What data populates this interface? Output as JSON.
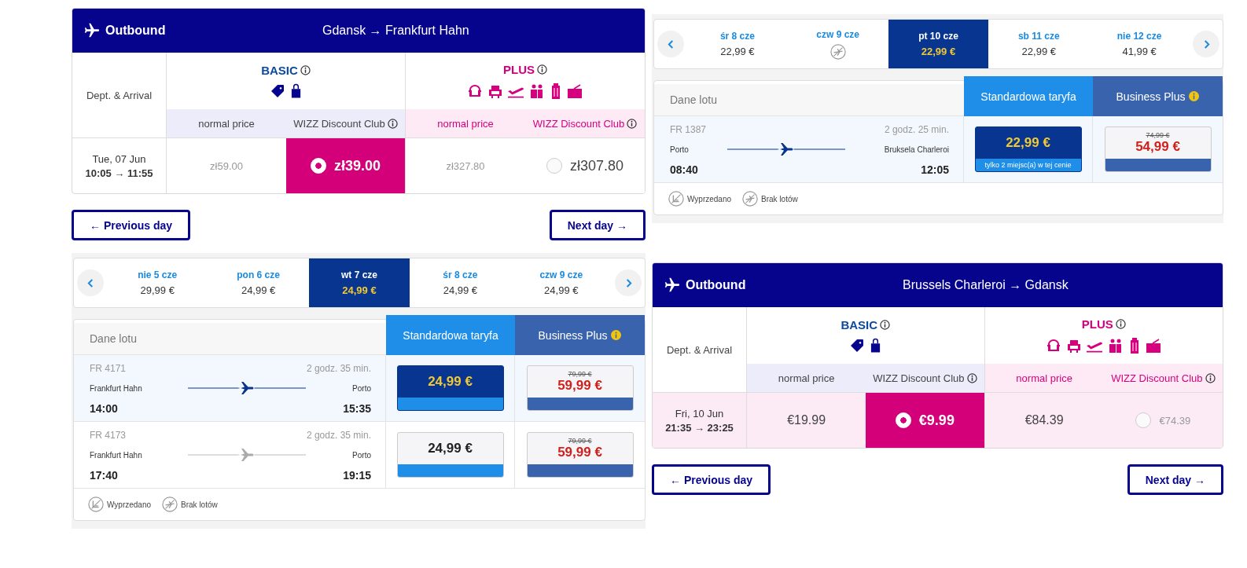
{
  "columns": [
    {
      "panels": [
        {
          "kind": "wizz",
          "direction": "Outbound",
          "route": "Gdansk → Frankfurt Hahn",
          "dept_label": "Dept. & Arrival",
          "fares": [
            {
              "name": "BASIC",
              "kind": "basic"
            },
            {
              "name": "PLUS",
              "kind": "plus"
            }
          ],
          "price_labels": [
            {
              "text": "normal price",
              "kind": "basic",
              "info": false
            },
            {
              "text": "WIZZ Discount Club",
              "kind": "basic",
              "info": true
            },
            {
              "text": "normal price",
              "kind": "plus",
              "info": false
            },
            {
              "text": "WIZZ Discount Club",
              "kind": "plus",
              "info": true
            }
          ],
          "flight": {
            "date": "Tue, 07 Jun",
            "times": "10:05 → 11:55",
            "highlighted": false
          },
          "prices": [
            {
              "value": "zł59.00",
              "kind": "plain",
              "selected": false,
              "muted": true
            },
            {
              "value": "zł39.00",
              "kind": "radio",
              "selected": true,
              "muted": false
            },
            {
              "value": "zł327.80",
              "kind": "plain",
              "selected": false,
              "muted": true
            },
            {
              "value": "zł307.80",
              "kind": "radio",
              "selected": false,
              "muted": false
            }
          ],
          "prev": "← Previous day",
          "next": "Next day →"
        },
        {
          "kind": "ryanair",
          "days": [
            {
              "label": "nie 5 cze",
              "price": "29,99 €",
              "kind": "price",
              "selected": false
            },
            {
              "label": "pon 6 cze",
              "price": "24,99 €",
              "kind": "price",
              "selected": false
            },
            {
              "label": "wt 7 cze",
              "price": "24,99 €",
              "kind": "price",
              "selected": true
            },
            {
              "label": "śr 8 cze",
              "price": "24,99 €",
              "kind": "price",
              "selected": false
            },
            {
              "label": "czw 9 cze",
              "price": "24,99 €",
              "kind": "price",
              "selected": false
            }
          ],
          "headers": {
            "info": "Dane lotu",
            "standard": "Standardowa taryfa",
            "business": "Business Plus"
          },
          "flights": [
            {
              "number": "FR 4171",
              "duration": "2 godz. 35 min.",
              "from": "Frankfurt Hahn",
              "to": "Porto",
              "dep": "14:00",
              "arr": "15:35",
              "selected": true,
              "standard": {
                "price": "24,99 €"
              },
              "business": {
                "old": "79,99 €",
                "price": "59,99 €"
              }
            },
            {
              "number": "FR 4173",
              "duration": "2 godz. 35 min.",
              "from": "Frankfurt Hahn",
              "to": "Porto",
              "dep": "17:40",
              "arr": "19:15",
              "selected": false,
              "standard": {
                "price": "24,99 €"
              },
              "business": {
                "old": "79,99 €",
                "price": "59,99 €"
              }
            }
          ],
          "legend": [
            {
              "kind": "sold-out",
              "label": "Wyprzedano"
            },
            {
              "kind": "no-flights",
              "label": "Brak lotów"
            }
          ]
        }
      ]
    },
    {
      "panels": [
        {
          "kind": "ryanair",
          "days": [
            {
              "label": "śr 8 cze",
              "price": "22,99 €",
              "kind": "price",
              "selected": false
            },
            {
              "label": "czw 9 cze",
              "kind": "no-flights",
              "selected": false
            },
            {
              "label": "pt 10 cze",
              "price": "22,99 €",
              "kind": "price",
              "selected": true
            },
            {
              "label": "sb 11 cze",
              "price": "22,99 €",
              "kind": "price",
              "selected": false
            },
            {
              "label": "nie 12 cze",
              "price": "41,99 €",
              "kind": "price",
              "selected": false
            }
          ],
          "headers": {
            "info": "Dane lotu",
            "standard": "Standardowa taryfa",
            "business": "Business Plus"
          },
          "flights": [
            {
              "number": "FR 1387",
              "duration": "2 godz. 25 min.",
              "from": "Porto",
              "to": "Bruksela Charleroi",
              "dep": "08:40",
              "arr": "12:05",
              "selected": true,
              "standard": {
                "price": "22,99 €",
                "note": "tylko 2 miejsc(a) w tej cenie"
              },
              "business": {
                "old": "74,99 €",
                "price": "54,99 €"
              }
            }
          ],
          "legend": [
            {
              "kind": "sold-out",
              "label": "Wyprzedano"
            },
            {
              "kind": "no-flights",
              "label": "Brak lotów"
            }
          ]
        },
        {
          "kind": "wizz",
          "direction": "Outbound",
          "route": "Brussels Charleroi → Gdansk",
          "dept_label": "Dept. & Arrival",
          "fares": [
            {
              "name": "BASIC",
              "kind": "basic"
            },
            {
              "name": "PLUS",
              "kind": "plus"
            }
          ],
          "price_labels": [
            {
              "text": "normal price",
              "kind": "basic",
              "info": false
            },
            {
              "text": "WIZZ Discount Club",
              "kind": "basic",
              "info": true
            },
            {
              "text": "normal price",
              "kind": "plus",
              "info": false
            },
            {
              "text": "WIZZ Discount Club",
              "kind": "plus",
              "info": true
            }
          ],
          "flight": {
            "date": "Fri, 10 Jun",
            "times": "21:35 → 23:25",
            "highlighted": true
          },
          "prices": [
            {
              "value": "€19.99",
              "kind": "plain",
              "selected": false,
              "muted": false
            },
            {
              "value": "€9.99",
              "kind": "radio",
              "selected": true,
              "muted": false
            },
            {
              "value": "€84.39",
              "kind": "plain",
              "selected": false,
              "muted": false
            },
            {
              "value": "€74.39",
              "kind": "radio",
              "selected": false,
              "muted": true
            }
          ],
          "prev": "← Previous day",
          "next": "Next day →"
        }
      ]
    }
  ]
}
